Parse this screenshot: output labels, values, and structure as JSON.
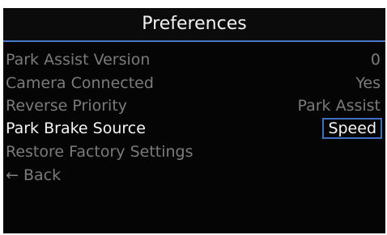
{
  "screen": {
    "title": "Preferences"
  },
  "menu": {
    "items": [
      {
        "label": "Park Assist Version",
        "value": "0"
      },
      {
        "label": "Camera Connected",
        "value": "Yes"
      },
      {
        "label": "Reverse Priority",
        "value": "Park Assist"
      },
      {
        "label": "Park Brake Source",
        "value": "Speed"
      },
      {
        "label": "Restore Factory Settings"
      },
      {
        "label": "← Back"
      }
    ]
  },
  "colors": {
    "accent": "#4a78c8",
    "background": "#050505",
    "text_active": "#f5f5f5",
    "text_inactive": "#7b7b7b"
  }
}
